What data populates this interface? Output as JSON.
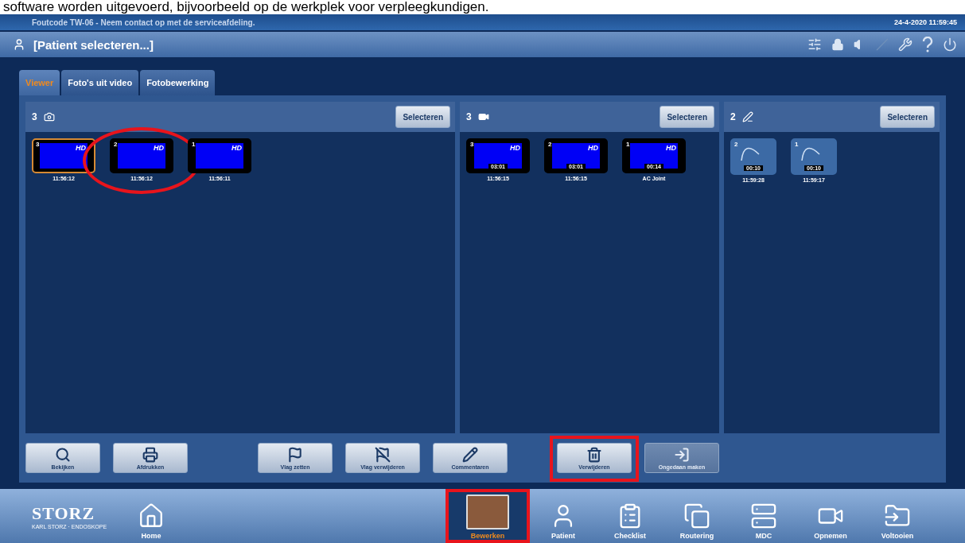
{
  "caption": "software worden uitgevoerd, bijvoorbeeld op de werkplek voor verpleegkundigen.",
  "title_bar": {
    "message": "Foutcode TW-06 - Neem contact op met de serviceafdeling.",
    "datetime": "24-4-2020  11:59:45"
  },
  "patient_bar": {
    "label": "[Patient selecteren...]"
  },
  "tabs": [
    {
      "label": "Viewer",
      "selected": true
    },
    {
      "label": "Foto's uit video",
      "selected": false
    },
    {
      "label": "Fotobewerking",
      "selected": false
    }
  ],
  "columns": [
    {
      "kind": "photo",
      "count": "3",
      "button": "Selecteren",
      "items": [
        {
          "number": "3",
          "badge": "HD",
          "caption": "11:56:12",
          "selected": true
        },
        {
          "number": "2",
          "badge": "HD",
          "caption": "11:56:12",
          "selected": false,
          "annotated": true
        },
        {
          "number": "1",
          "badge": "HD",
          "caption": "11:56:11",
          "selected": false
        }
      ]
    },
    {
      "kind": "video",
      "count": "3",
      "button": "Selecteren",
      "items": [
        {
          "number": "3",
          "badge": "HD",
          "duration": "03:01",
          "caption": "11:56:15",
          "selected": false
        },
        {
          "number": "2",
          "badge": "HD",
          "duration": "03:01",
          "caption": "11:56:15",
          "selected": false
        },
        {
          "number": "1",
          "badge": "HD",
          "duration": "00:14",
          "caption": "AC Joint",
          "selected": false
        }
      ]
    },
    {
      "kind": "drawing",
      "count": "2",
      "button": "Selecteren",
      "items": [
        {
          "number": "2",
          "duration": "00:10",
          "caption": "11:59:28",
          "selected": false
        },
        {
          "number": "1",
          "duration": "00:10",
          "caption": "11:59:17",
          "selected": false
        }
      ]
    }
  ],
  "actions": [
    {
      "kind": "search",
      "label": "Bekijken",
      "disabled": false
    },
    {
      "kind": "print",
      "label": "Afdrukken",
      "disabled": false
    },
    {
      "kind": "flag",
      "label": "Vlag zetten",
      "disabled": false
    },
    {
      "kind": "unflag",
      "label": "Vlag verwijderen",
      "disabled": false
    },
    {
      "kind": "comment",
      "label": "Commentaren",
      "disabled": false
    },
    {
      "kind": "delete",
      "label": "Verwijderen",
      "disabled": false,
      "annotated": true
    },
    {
      "kind": "undo",
      "label": "Ongedaan maken",
      "disabled": true
    }
  ],
  "logo": {
    "name": "STORZ",
    "tagline": "KARL STORZ · ENDOSKOPE"
  },
  "nav": [
    {
      "kind": "home",
      "label": "Home",
      "selected": false
    },
    {
      "kind": "edit",
      "label": "Bewerken",
      "selected": true,
      "annotated": true
    },
    {
      "kind": "patient",
      "label": "Patient",
      "selected": false
    },
    {
      "kind": "checklist",
      "label": "Checklist",
      "selected": false
    },
    {
      "kind": "routing",
      "label": "Routering",
      "selected": false
    },
    {
      "kind": "mdc",
      "label": "MDC",
      "selected": false
    },
    {
      "kind": "record",
      "label": "Opnemen",
      "selected": false
    },
    {
      "kind": "finish",
      "label": "Voltooien",
      "selected": false
    }
  ]
}
